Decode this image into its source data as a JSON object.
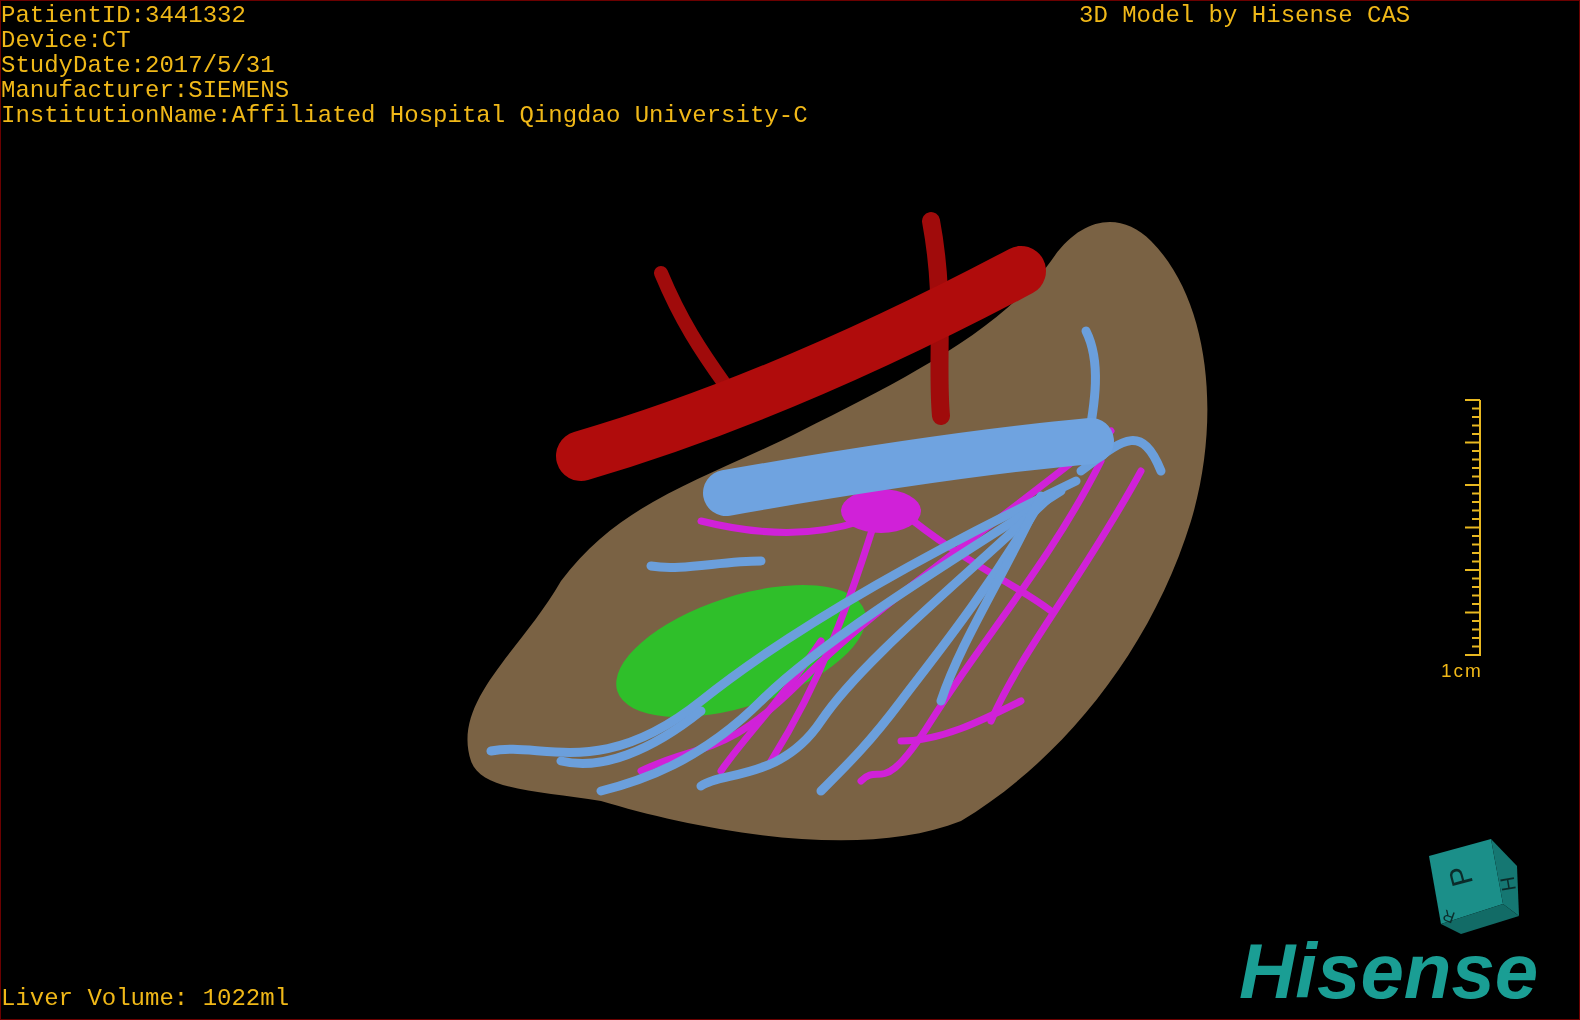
{
  "patient_info": [
    "PatientID:3441332",
    "Device:CT",
    "StudyDate:2017/5/31",
    "Manufacturer:SIEMENS",
    "InstitutionName:Affiliated Hospital Qingdao University-C"
  ],
  "title": "3D Model by Hisense CAS",
  "scale_bar": {
    "label": "1cm"
  },
  "orientation_cube": {
    "faces": [
      "P",
      "H",
      "R"
    ]
  },
  "liver_volume": "Liver Volume: 1022ml",
  "logo": "Hisense"
}
